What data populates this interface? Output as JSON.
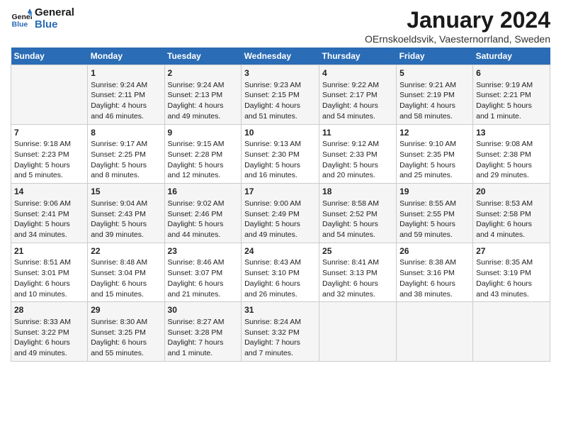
{
  "logo": {
    "line1": "General",
    "line2": "Blue"
  },
  "title": "January 2024",
  "location": "OErnskoeldsvik, Vaesternorrland, Sweden",
  "days_header": [
    "Sunday",
    "Monday",
    "Tuesday",
    "Wednesday",
    "Thursday",
    "Friday",
    "Saturday"
  ],
  "weeks": [
    [
      {
        "day": "",
        "content": ""
      },
      {
        "day": "1",
        "content": "Sunrise: 9:24 AM\nSunset: 2:11 PM\nDaylight: 4 hours\nand 46 minutes."
      },
      {
        "day": "2",
        "content": "Sunrise: 9:24 AM\nSunset: 2:13 PM\nDaylight: 4 hours\nand 49 minutes."
      },
      {
        "day": "3",
        "content": "Sunrise: 9:23 AM\nSunset: 2:15 PM\nDaylight: 4 hours\nand 51 minutes."
      },
      {
        "day": "4",
        "content": "Sunrise: 9:22 AM\nSunset: 2:17 PM\nDaylight: 4 hours\nand 54 minutes."
      },
      {
        "day": "5",
        "content": "Sunrise: 9:21 AM\nSunset: 2:19 PM\nDaylight: 4 hours\nand 58 minutes."
      },
      {
        "day": "6",
        "content": "Sunrise: 9:19 AM\nSunset: 2:21 PM\nDaylight: 5 hours\nand 1 minute."
      }
    ],
    [
      {
        "day": "7",
        "content": "Sunrise: 9:18 AM\nSunset: 2:23 PM\nDaylight: 5 hours\nand 5 minutes."
      },
      {
        "day": "8",
        "content": "Sunrise: 9:17 AM\nSunset: 2:25 PM\nDaylight: 5 hours\nand 8 minutes."
      },
      {
        "day": "9",
        "content": "Sunrise: 9:15 AM\nSunset: 2:28 PM\nDaylight: 5 hours\nand 12 minutes."
      },
      {
        "day": "10",
        "content": "Sunrise: 9:13 AM\nSunset: 2:30 PM\nDaylight: 5 hours\nand 16 minutes."
      },
      {
        "day": "11",
        "content": "Sunrise: 9:12 AM\nSunset: 2:33 PM\nDaylight: 5 hours\nand 20 minutes."
      },
      {
        "day": "12",
        "content": "Sunrise: 9:10 AM\nSunset: 2:35 PM\nDaylight: 5 hours\nand 25 minutes."
      },
      {
        "day": "13",
        "content": "Sunrise: 9:08 AM\nSunset: 2:38 PM\nDaylight: 5 hours\nand 29 minutes."
      }
    ],
    [
      {
        "day": "14",
        "content": "Sunrise: 9:06 AM\nSunset: 2:41 PM\nDaylight: 5 hours\nand 34 minutes."
      },
      {
        "day": "15",
        "content": "Sunrise: 9:04 AM\nSunset: 2:43 PM\nDaylight: 5 hours\nand 39 minutes."
      },
      {
        "day": "16",
        "content": "Sunrise: 9:02 AM\nSunset: 2:46 PM\nDaylight: 5 hours\nand 44 minutes."
      },
      {
        "day": "17",
        "content": "Sunrise: 9:00 AM\nSunset: 2:49 PM\nDaylight: 5 hours\nand 49 minutes."
      },
      {
        "day": "18",
        "content": "Sunrise: 8:58 AM\nSunset: 2:52 PM\nDaylight: 5 hours\nand 54 minutes."
      },
      {
        "day": "19",
        "content": "Sunrise: 8:55 AM\nSunset: 2:55 PM\nDaylight: 5 hours\nand 59 minutes."
      },
      {
        "day": "20",
        "content": "Sunrise: 8:53 AM\nSunset: 2:58 PM\nDaylight: 6 hours\nand 4 minutes."
      }
    ],
    [
      {
        "day": "21",
        "content": "Sunrise: 8:51 AM\nSunset: 3:01 PM\nDaylight: 6 hours\nand 10 minutes."
      },
      {
        "day": "22",
        "content": "Sunrise: 8:48 AM\nSunset: 3:04 PM\nDaylight: 6 hours\nand 15 minutes."
      },
      {
        "day": "23",
        "content": "Sunrise: 8:46 AM\nSunset: 3:07 PM\nDaylight: 6 hours\nand 21 minutes."
      },
      {
        "day": "24",
        "content": "Sunrise: 8:43 AM\nSunset: 3:10 PM\nDaylight: 6 hours\nand 26 minutes."
      },
      {
        "day": "25",
        "content": "Sunrise: 8:41 AM\nSunset: 3:13 PM\nDaylight: 6 hours\nand 32 minutes."
      },
      {
        "day": "26",
        "content": "Sunrise: 8:38 AM\nSunset: 3:16 PM\nDaylight: 6 hours\nand 38 minutes."
      },
      {
        "day": "27",
        "content": "Sunrise: 8:35 AM\nSunset: 3:19 PM\nDaylight: 6 hours\nand 43 minutes."
      }
    ],
    [
      {
        "day": "28",
        "content": "Sunrise: 8:33 AM\nSunset: 3:22 PM\nDaylight: 6 hours\nand 49 minutes."
      },
      {
        "day": "29",
        "content": "Sunrise: 8:30 AM\nSunset: 3:25 PM\nDaylight: 6 hours\nand 55 minutes."
      },
      {
        "day": "30",
        "content": "Sunrise: 8:27 AM\nSunset: 3:28 PM\nDaylight: 7 hours\nand 1 minute."
      },
      {
        "day": "31",
        "content": "Sunrise: 8:24 AM\nSunset: 3:32 PM\nDaylight: 7 hours\nand 7 minutes."
      },
      {
        "day": "",
        "content": ""
      },
      {
        "day": "",
        "content": ""
      },
      {
        "day": "",
        "content": ""
      }
    ]
  ]
}
